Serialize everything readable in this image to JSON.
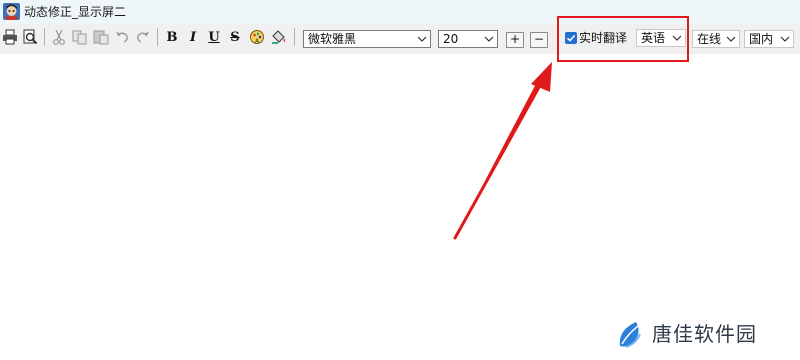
{
  "window": {
    "title": "动态修正_显示屏二"
  },
  "toolbar": {
    "bold_label": "B",
    "italic_label": "I",
    "underline_label": "U",
    "strike_label": "S",
    "font_family": "微软雅黑",
    "font_size": "20",
    "increase_label": "+",
    "decrease_label": "−",
    "realtime_translate_label": "实时翻译",
    "realtime_translate_checked": true,
    "language": "英语",
    "mode": "在线",
    "region": "国内"
  },
  "colors": {
    "highlight": "#e0191b",
    "checkbox": "#1f6fd1"
  },
  "watermark": {
    "text": "唐佳软件园"
  }
}
